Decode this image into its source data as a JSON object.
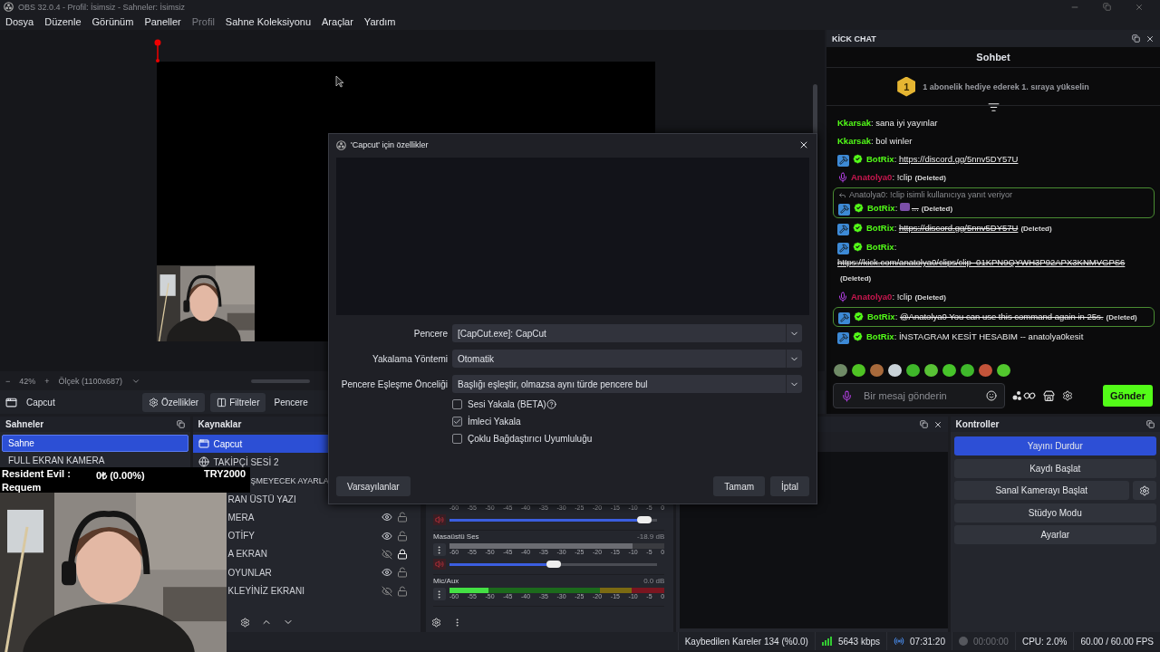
{
  "window": {
    "title": "OBS 32.0.4 - Profil: İsimsiz - Sahneler: İsimsiz"
  },
  "menu": [
    {
      "label": "Dosya",
      "disabled": false
    },
    {
      "label": "Düzenle",
      "disabled": false
    },
    {
      "label": "Görünüm",
      "disabled": false
    },
    {
      "label": "Paneller",
      "disabled": false
    },
    {
      "label": "Profil",
      "disabled": true
    },
    {
      "label": "Sahne Koleksiyonu",
      "disabled": false
    },
    {
      "label": "Araçlar",
      "disabled": false
    },
    {
      "label": "Yardım",
      "disabled": false
    }
  ],
  "preview": {
    "zoom_out": "−",
    "zoom": "42%",
    "zoom_in": "+",
    "scale": "Ölçek (1100x687)"
  },
  "source_toolbar": {
    "source": "Capcut",
    "buttons": [
      {
        "kind": "gear",
        "label": "Özellikler"
      },
      {
        "kind": "filter",
        "label": "Filtreler"
      },
      {
        "kind": "plain",
        "label": "Pencere"
      }
    ]
  },
  "scenes": {
    "title": "Sahneler",
    "items": [
      {
        "label": "Sahne",
        "selected": true
      },
      {
        "label": "FULL EKRAN KAMERA",
        "selected": false
      }
    ]
  },
  "sources": {
    "title": "Kaynaklar",
    "items": [
      {
        "kind": "window",
        "label": "Capcut",
        "selected": true
      },
      {
        "kind": "globe",
        "label": "TAKİPÇİ SESİ 2",
        "selected": false
      },
      {
        "kind": "cut_bar",
        "label": "ŞMEYECEK AYARLA",
        "selected": false
      },
      {
        "kind": "cut",
        "label": "RAN ÜSTÜ YAZI",
        "selected": false
      },
      {
        "kind": "cut",
        "label": "MERA",
        "selected": false,
        "visible": true,
        "locked": false
      },
      {
        "kind": "cut",
        "label": "OTİFY",
        "selected": false,
        "visible": true,
        "locked": false
      },
      {
        "kind": "cut",
        "label": "A EKRAN",
        "selected": false,
        "visible": false,
        "locked": true
      },
      {
        "kind": "cut",
        "label": "OYUNLAR",
        "selected": false,
        "visible": true,
        "locked": false
      },
      {
        "kind": "cut",
        "label": "KLEYİNİZ EKRANI",
        "selected": false,
        "visible": false,
        "locked": false
      }
    ]
  },
  "audio_mixer": {
    "channels": [
      {
        "kind": "partial",
        "muted": true,
        "ticks": [
          "-60",
          "-55",
          "-50",
          "-45",
          "-40",
          "-35",
          "-30",
          "-25",
          "-20",
          "-15",
          "-10",
          "-5",
          "0"
        ],
        "volume": {
          "level": 0.97
        }
      },
      {
        "kind": "full",
        "name": "Masaüstü Ses",
        "reading": "-18.9 dB",
        "muted": true,
        "meter": {
          "level": 0.85
        },
        "ticks": [
          "-60",
          "-55",
          "-50",
          "-45",
          "-40",
          "-35",
          "-30",
          "-25",
          "-20",
          "-15",
          "-10",
          "-5",
          "0"
        ],
        "volume": {
          "level": 0.5
        }
      },
      {
        "kind": "full",
        "name": "Mic/Aux",
        "reading": "0.0 dB",
        "muted": false,
        "meter": {
          "level": 0.18
        },
        "ticks": [
          "-60",
          "-55",
          "-50",
          "-45",
          "-40",
          "-35",
          "-30",
          "-25",
          "-20",
          "-15",
          "-10",
          "-5",
          "0"
        ]
      }
    ]
  },
  "controls": {
    "title": "Kontroller",
    "buttons": [
      {
        "kind": "plain",
        "label": "Yayını Durdur",
        "active": true
      },
      {
        "kind": "plain",
        "label": "Kaydı Başlat",
        "active": false
      },
      {
        "kind": "with_settings",
        "label": "Sanal Kamerayı Başlat",
        "active": false
      },
      {
        "kind": "plain",
        "label": "Stüdyo Modu",
        "active": false
      },
      {
        "kind": "plain",
        "label": "Ayarlar",
        "active": false
      }
    ]
  },
  "status_bar": {
    "dropped": "Kaybedilen Kareler 134 (%0.0)",
    "bitrate": "5643 kbps",
    "stream_time": "07:31:20",
    "record_time": "00:00:00",
    "cpu": "CPU: 2.0%",
    "fps": "60.00 / 60.00 FPS"
  },
  "chat": {
    "title": "KİCK CHAT",
    "heading": "Sohbet",
    "goal": {
      "rank": "1",
      "text": "1 abonelik hediye ederek 1. sıraya yükselin"
    },
    "messages": [
      {
        "kind": "plain",
        "user": "Kkarsak",
        "sep": ":",
        "color": "#53fc18",
        "text": "sana iyi yayınlar",
        "struck": false,
        "highlighted": false
      },
      {
        "kind": "plain",
        "user": "Kkarsak",
        "sep": ":",
        "color": "#53fc18",
        "text": "bol winler",
        "struck": false,
        "highlighted": false
      },
      {
        "kind": "bot",
        "user": "BotRix",
        "sep": ":",
        "color": "#53fc18",
        "link": "https://discord.gg/5nnv5DY57U",
        "struck": false,
        "highlighted": false
      },
      {
        "kind": "mod",
        "user": "Anatolya0",
        "sep": ":",
        "color": "#c8174f",
        "text": "!clip",
        "note": "(Deleted)",
        "struck": false,
        "highlighted": false
      },
      {
        "kind": "bot",
        "user": "BotRix",
        "sep": ":",
        "color": "#53fc18",
        "reply": "Anatolya0: !clip isimli kullanıcıya yanıt veriyor",
        "emote": true,
        "text": "...",
        "note": "(Deleted)",
        "struck": true,
        "highlighted": true
      },
      {
        "kind": "bot",
        "user": "BotRix",
        "sep": ":",
        "color": "#53fc18",
        "link": "https://discord.gg/5nnv5DY57U",
        "note": "(Deleted)",
        "struck": true,
        "highlighted": false
      },
      {
        "kind": "bot",
        "user": "BotRix",
        "sep": ":",
        "color": "#53fc18",
        "link": "https://kick.com/anatolya0/clips/clip_01KPN9QYWH3P92APX3KNMVGPS6",
        "note": "(Deleted)",
        "struck": true,
        "highlighted": false
      },
      {
        "kind": "mod",
        "user": "Anatolya0",
        "sep": ":",
        "color": "#c8174f",
        "text": "!clip",
        "note": "(Deleted)",
        "struck": false,
        "highlighted": false
      },
      {
        "kind": "bot",
        "user": "BotRix",
        "sep": ":",
        "color": "#53fc18",
        "text": "@Anatolya0 You can use this command again in 25s.",
        "note": "(Deleted)",
        "struck": true,
        "highlighted": true
      },
      {
        "kind": "bot",
        "user": "BotRix",
        "sep": ":",
        "color": "#53fc18",
        "text": "İNSTAGRAM KESİT HESABIM -- anatolya0kesit",
        "struck": false,
        "highlighted": false
      }
    ],
    "emotes": [
      {
        "color": "#6f8a66"
      },
      {
        "color": "#4fc324"
      },
      {
        "color": "#a86a3c"
      },
      {
        "color": "#c9d2d8"
      },
      {
        "color": "#3fb72a"
      },
      {
        "color": "#58c235"
      },
      {
        "color": "#47c42a"
      },
      {
        "color": "#3fb82b"
      },
      {
        "color": "#c3543a"
      },
      {
        "color": "#52c72e"
      }
    ],
    "input": {
      "placeholder": "Bir mesaj gönderin"
    },
    "send": "Gönder"
  },
  "dialog": {
    "title": "'Capcut' için özellikler",
    "fields": [
      {
        "label": "Pencere",
        "value": "[CapCut.exe]: CapCut"
      },
      {
        "label": "Yakalama Yöntemi",
        "value": "Otomatik"
      },
      {
        "label": "Pencere Eşleşme Önceliği",
        "value": "Başlığı eşleştir, olmazsa aynı türde pencere bul"
      }
    ],
    "checkboxes": [
      {
        "label": "Sesi Yakala (BETA)",
        "checked": false,
        "help": true
      },
      {
        "label": "İmleci Yakala",
        "checked": true,
        "help": false
      },
      {
        "label": "Çoklu Bağdaştırıcı Uyumluluğu",
        "checked": false,
        "help": false
      }
    ],
    "defaults": "Varsayılanlar",
    "ok": "Tamam",
    "cancel": "İptal"
  },
  "overlay": {
    "game": "Resident Evil :",
    "amount": "0₺ (0.00%)",
    "goal": "TRY2000",
    "subtitle": "Requem"
  }
}
